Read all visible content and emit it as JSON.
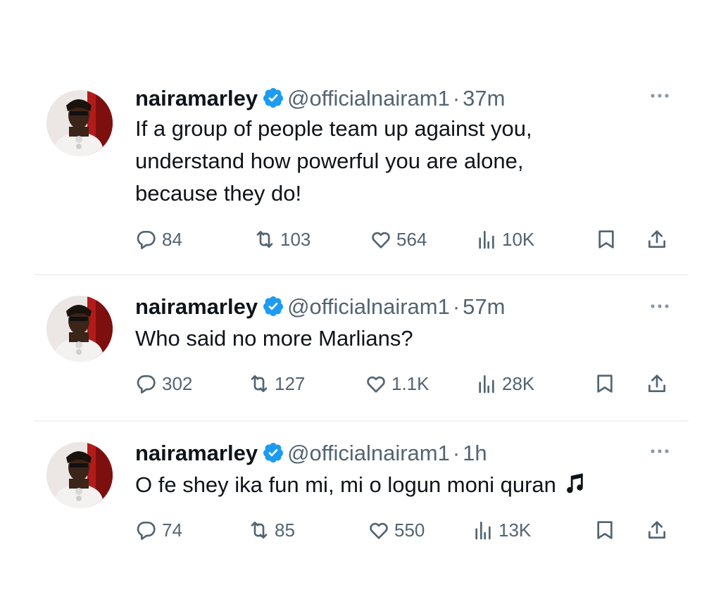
{
  "tweets": [
    {
      "name": "nairamarley",
      "handle": "@officialnairam1",
      "dot": "·",
      "time": "37m",
      "lines": [
        "If a group of people team up against you,",
        "understand how powerful you are alone,",
        "because they do!"
      ],
      "replies": "84",
      "reposts": "103",
      "likes": "564",
      "views": "10K"
    },
    {
      "name": "nairamarley",
      "handle": "@officialnairam1",
      "dot": "·",
      "time": "57m",
      "lines": [
        "Who said no more Marlians?"
      ],
      "replies": "302",
      "reposts": "127",
      "likes": "1.1K",
      "views": "28K"
    },
    {
      "name": "nairamarley",
      "handle": "@officialnairam1",
      "dot": "·",
      "time": "1h",
      "lines": [
        "O fe shey ika fun mi, mi o logun moni quran"
      ],
      "replies": "74",
      "reposts": "85",
      "likes": "550",
      "views": "13K"
    }
  ],
  "colors": {
    "text": "#0f1419",
    "secondary": "#536471",
    "verified": "#1d9bf0",
    "divider": "#eff3f4"
  },
  "icons": [
    "verified-badge-icon",
    "more-icon",
    "reply-icon",
    "repost-icon",
    "like-icon",
    "views-icon",
    "bookmark-icon",
    "share-icon",
    "music-note-icon"
  ]
}
